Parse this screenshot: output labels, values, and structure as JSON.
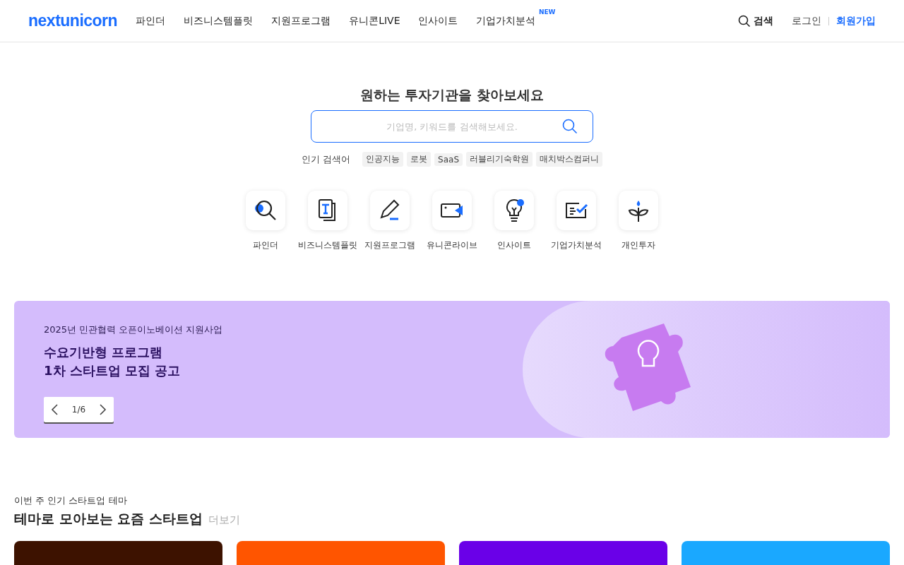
{
  "header": {
    "logo": "nextunicorn",
    "nav": [
      {
        "label": "파인더"
      },
      {
        "label": "비즈니스템플릿"
      },
      {
        "label": "지원프로그램"
      },
      {
        "label": "유니콘LIVE"
      },
      {
        "label": "인사이트"
      },
      {
        "label": "기업가치분석",
        "badge": "NEW"
      }
    ],
    "search": "검색",
    "login": "로그인",
    "signup": "회원가입"
  },
  "hero": {
    "title": "원하는 투자기관을 찾아보세요",
    "search": {
      "placeholder": "기업명, 키워드를 검색해보세요."
    },
    "popular_label": "인기 검색어",
    "popular": [
      "인공지능",
      "로봇",
      "SaaS",
      "러블리기숙학원",
      "매치박스컴퍼니"
    ]
  },
  "shortcuts": [
    {
      "kind": "finder",
      "label": "파인더"
    },
    {
      "kind": "template",
      "label": "비즈니스템플릿"
    },
    {
      "kind": "program",
      "label": "지원프로그램"
    },
    {
      "kind": "live",
      "label": "유니콘라이브"
    },
    {
      "kind": "insight",
      "label": "인사이트"
    },
    {
      "kind": "valuation",
      "label": "기업가치분석"
    },
    {
      "kind": "invest",
      "label": "개인투자"
    }
  ],
  "banner": {
    "eyebrow": "2025년 민관협력 오픈이노베이션 지원사업",
    "title_lines": [
      "수요기반형 프로그램",
      "1차 스타트업 모집 공고"
    ],
    "pager": "1/6"
  },
  "themes": {
    "eyebrow": "이번 주 인기 스타트업 테마",
    "title": "테마로 모아보는 요즘 스타트업",
    "more": "더보기",
    "cards": [
      {
        "color": "#3d1200"
      },
      {
        "color": "#ff5500"
      },
      {
        "color": "#6a00e8"
      },
      {
        "color": "#1aa8ff"
      }
    ]
  }
}
